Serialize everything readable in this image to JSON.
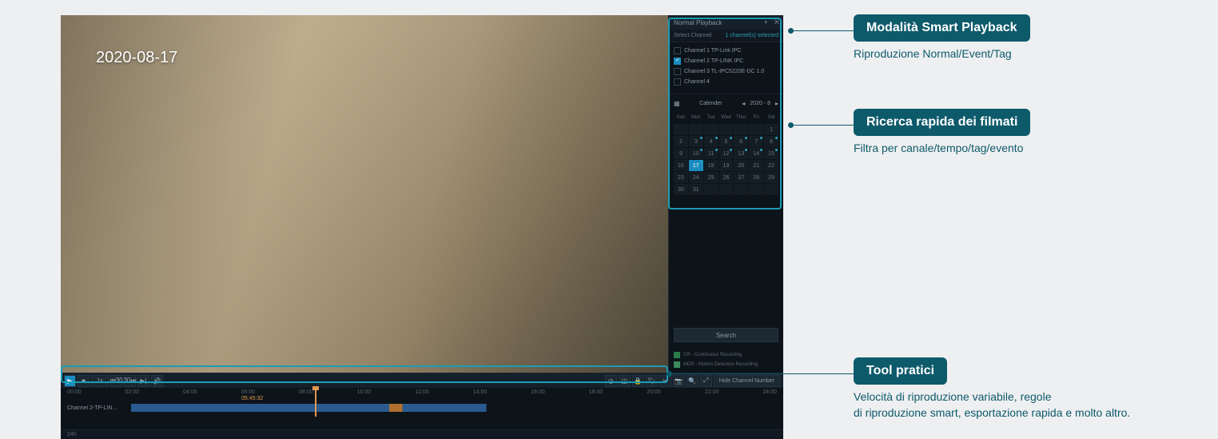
{
  "video": {
    "date_overlay": "2020-08-17"
  },
  "sidebar": {
    "mode_label": "Normal Playback",
    "select_channel_label": "Select Channel",
    "channels_selected": "1 channel(s) selected",
    "channels": [
      {
        "label": "Channel 1 TP-Link IPC",
        "checked": false
      },
      {
        "label": "Channel 2 TP-LINK IPC",
        "checked": true
      },
      {
        "label": "Channel 3 TL-IPC5220E-DC 1.0",
        "checked": false
      },
      {
        "label": "Channel 4",
        "checked": false
      }
    ]
  },
  "calendar": {
    "title": "Calender",
    "month_label": "2020 - 8",
    "weekdays": [
      "Sun",
      "Mon",
      "Tue",
      "Wed",
      "Thur",
      "Fri",
      "Sat"
    ],
    "rows": [
      [
        "",
        "",
        "",
        "",
        "",
        "",
        "1"
      ],
      [
        "2",
        "3",
        "4",
        "5",
        "6",
        "7",
        "8"
      ],
      [
        "9",
        "10",
        "11",
        "12",
        "13",
        "14",
        "15"
      ],
      [
        "16",
        "17",
        "18",
        "19",
        "20",
        "21",
        "22"
      ],
      [
        "23",
        "24",
        "25",
        "26",
        "27",
        "28",
        "29"
      ],
      [
        "30",
        "31",
        "",
        "",
        "",
        "",
        ""
      ]
    ],
    "has_recording": [
      "3",
      "4",
      "5",
      "6",
      "7",
      "8",
      "10",
      "11",
      "12",
      "13",
      "14",
      "15",
      "17"
    ],
    "selected": "17"
  },
  "playback": {
    "speed": "1x",
    "hide_channel_label": "Hide Channel Number",
    "time_ticks": [
      "00:00",
      "02:00",
      "04:00",
      "06:00",
      "08:00",
      "10:00",
      "12:00",
      "14:00",
      "16:00",
      "18:00",
      "20:00",
      "22:00",
      "24:00"
    ],
    "current_time": "05:45:32",
    "track_label": "Channel 2-TP-LIN...",
    "range_label": "24h"
  },
  "search": {
    "button_label": "Search"
  },
  "legend": {
    "cr": "CR - Continuous Recording",
    "mdr": "MDR - Motion Detection Recording"
  },
  "callouts": {
    "c1": {
      "title": "Modalità Smart Playback",
      "desc": "Riproduzione Normal/Event/Tag"
    },
    "c2": {
      "title": "Ricerca rapida dei filmati",
      "desc": "Filtra per canale/tempo/tag/evento"
    },
    "c3": {
      "title": "Tool pratici",
      "desc": "Velocità di riproduzione variabile, regole\ndi riproduzione smart, esportazione rapida e molto altro."
    }
  }
}
